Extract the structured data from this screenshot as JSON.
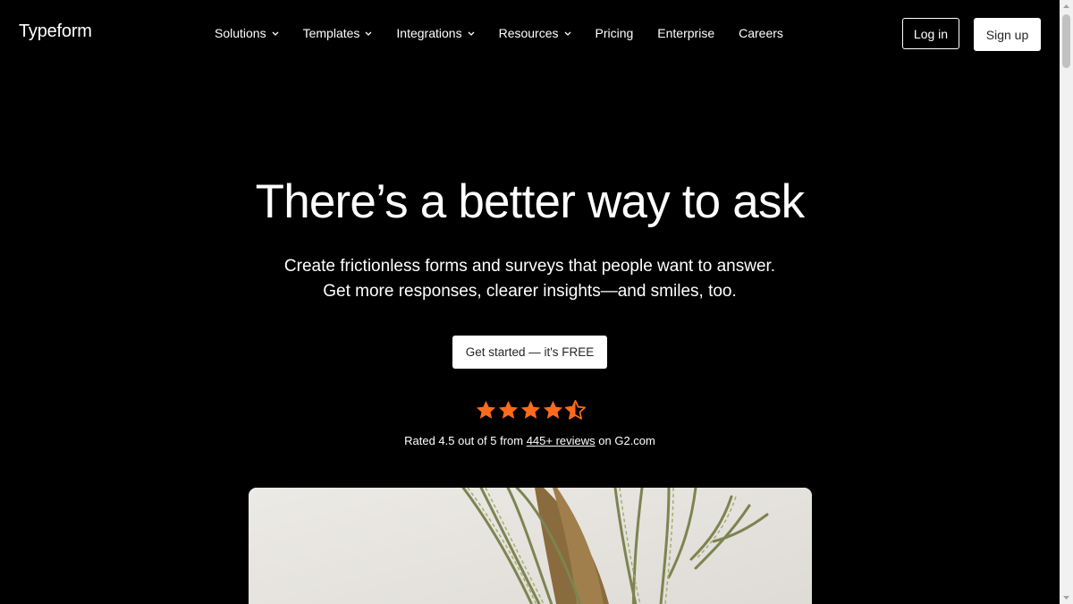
{
  "brand": {
    "name": "Typeform"
  },
  "nav": {
    "items": [
      {
        "label": "Solutions",
        "dropdown": true
      },
      {
        "label": "Templates",
        "dropdown": true
      },
      {
        "label": "Integrations",
        "dropdown": true
      },
      {
        "label": "Resources",
        "dropdown": true
      },
      {
        "label": "Pricing",
        "dropdown": false
      },
      {
        "label": "Enterprise",
        "dropdown": false
      },
      {
        "label": "Careers",
        "dropdown": false
      }
    ],
    "login_label": "Log in",
    "signup_label": "Sign up"
  },
  "hero": {
    "title": "There’s a better way to ask",
    "subtitle_line1": "Create frictionless forms and surveys that people want to answer.",
    "subtitle_line2": "Get more responses, clearer insights—and smiles, too.",
    "cta_label": "Get started — it's FREE"
  },
  "rating": {
    "value": 4.5,
    "max": 5,
    "prefix": "Rated 4.5 out of 5 from ",
    "reviews_link": "445+ reviews",
    "suffix": " on G2.com"
  },
  "colors": {
    "background": "#000000",
    "star": "#ff6b1a",
    "text": "#ffffff"
  }
}
